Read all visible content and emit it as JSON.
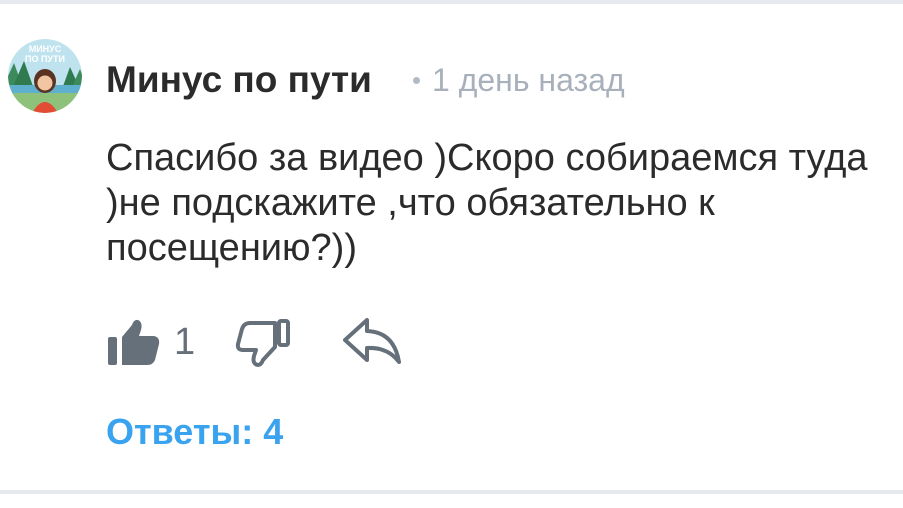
{
  "comment": {
    "author": "Минус по пути",
    "time": "1 день назад",
    "text": "Спасибо за видео )Скоро собираемся туда )не подскажите ,что обязательно к посещению?))",
    "likes": "1",
    "replies_label": "Ответы: 4"
  },
  "avatar": {
    "logo_line1": "МИНУС",
    "logo_line2": "ПО ПУТИ"
  },
  "icons": {
    "like": "thumbs-up-icon",
    "dislike": "thumbs-down-icon",
    "reply": "reply-arrow-icon"
  },
  "colors": {
    "accent": "#3aa3f0",
    "icon": "#66707a",
    "meta": "#a8b1bb"
  }
}
